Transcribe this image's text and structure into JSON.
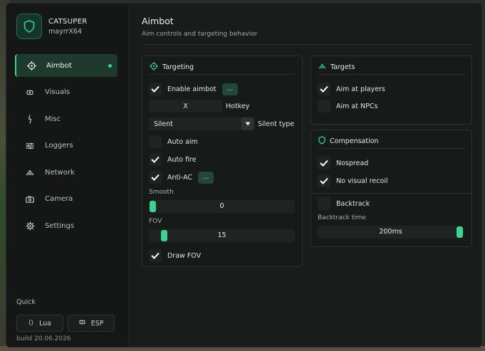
{
  "brand": {
    "name": "CATSUPER",
    "user": "mayrrX64"
  },
  "sidebar": {
    "items": [
      {
        "label": "Aimbot",
        "icon": "crosshair-icon",
        "active": true
      },
      {
        "label": "Visuals",
        "icon": "eye-icon",
        "active": false
      },
      {
        "label": "Misc",
        "icon": "lightning-icon",
        "active": false
      },
      {
        "label": "Loggers",
        "icon": "sliders-icon",
        "active": false
      },
      {
        "label": "Network",
        "icon": "signal-icon",
        "active": false
      },
      {
        "label": "Camera",
        "icon": "camera-icon",
        "active": false
      },
      {
        "label": "Settings",
        "icon": "gear-icon",
        "active": false
      }
    ],
    "quick_label": "Quick",
    "quick_buttons": [
      {
        "label": "Lua",
        "icon": "braces-icon"
      },
      {
        "label": "ESP",
        "icon": "eye-icon"
      }
    ],
    "build": "build 20.06.2026"
  },
  "page": {
    "title": "Aimbot",
    "subtitle": "Aim controls and targeting behavior"
  },
  "targeting": {
    "title": "Targeting",
    "enable_aimbot": {
      "label": "Enable aimbot",
      "checked": true,
      "more": "..."
    },
    "hotkey": {
      "value": "X",
      "label": "Hotkey"
    },
    "silent_type": {
      "value": "Silent",
      "label": "Silent type"
    },
    "auto_aim": {
      "label": "Auto aim",
      "checked": false
    },
    "auto_fire": {
      "label": "Auto fire",
      "checked": true
    },
    "anti_ac": {
      "label": "Anti-AC",
      "checked": true,
      "more": "..."
    },
    "smooth": {
      "label": "Smooth",
      "value": "0",
      "fraction": 0.0
    },
    "fov": {
      "label": "FOV",
      "value": "15",
      "fraction": 0.08
    },
    "draw_fov": {
      "label": "Draw FOV",
      "checked": true
    }
  },
  "targets": {
    "title": "Targets",
    "aim_at_players": {
      "label": "Aim at players",
      "checked": true
    },
    "aim_at_npcs": {
      "label": "Aim at NPCs",
      "checked": false
    }
  },
  "compensation": {
    "title": "Compensation",
    "nospread": {
      "label": "Nospread",
      "checked": true
    },
    "no_visual_recoil": {
      "label": "No visual recoil",
      "checked": true
    },
    "backtrack": {
      "label": "Backtrack",
      "checked": false
    },
    "backtrack_time": {
      "label": "Backtrack time",
      "value": "200ms",
      "fraction": 1.0
    }
  },
  "colors": {
    "accent": "#3ed193",
    "panel_bg": "#161a18",
    "window_bg": "#171a19"
  }
}
